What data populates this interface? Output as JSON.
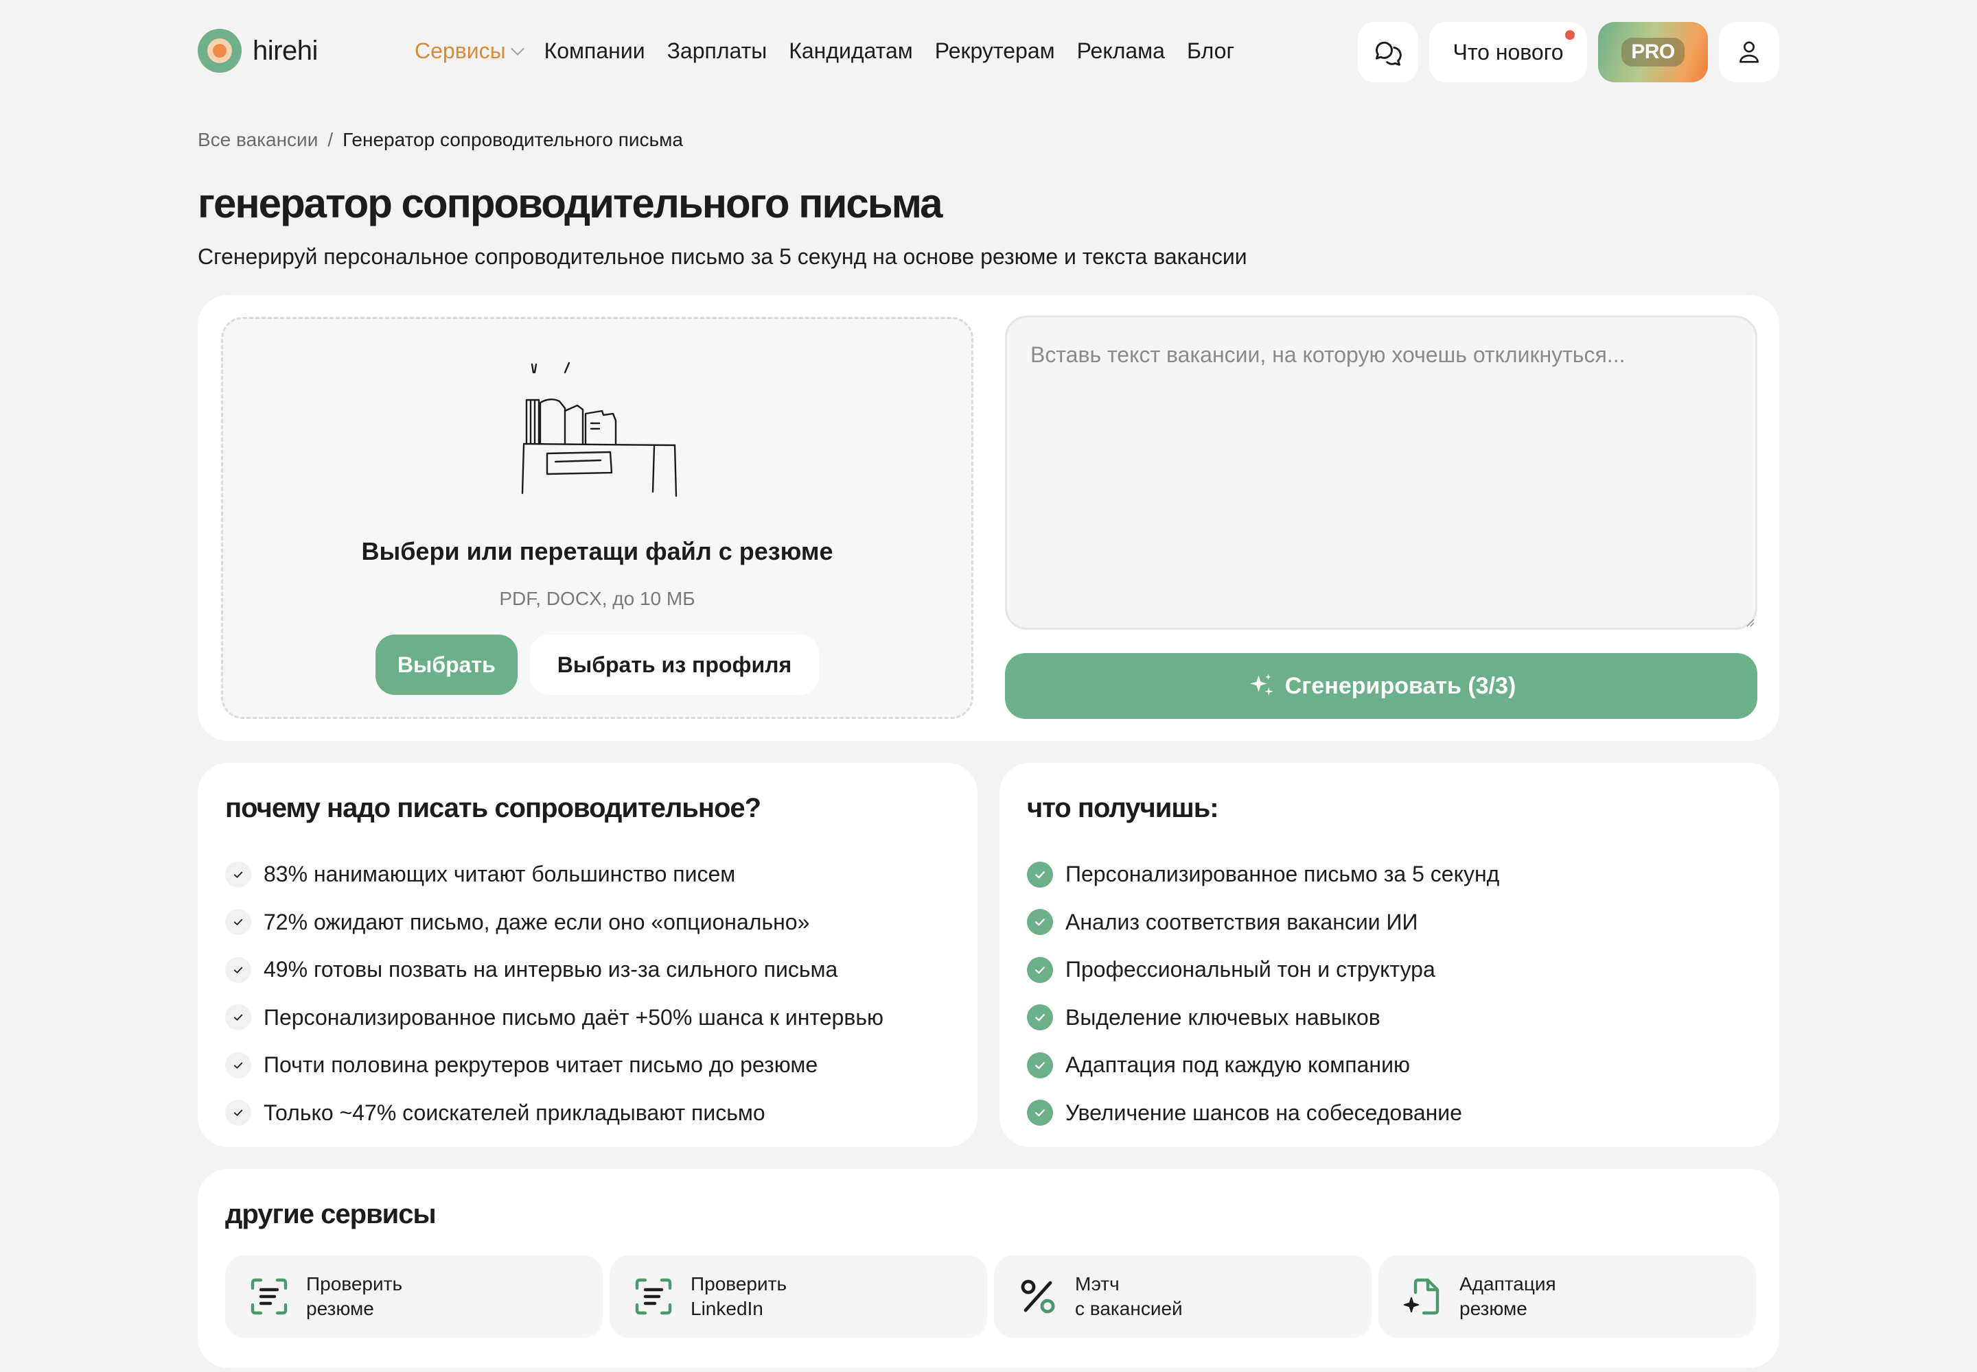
{
  "logo": {
    "text": "hirehi"
  },
  "nav": {
    "services": "Сервисы",
    "companies": "Компании",
    "salaries": "Зарплаты",
    "candidates": "Кандидатам",
    "recruiters": "Рекрутерам",
    "ads": "Реклама",
    "blog": "Блог"
  },
  "header": {
    "whats_new": "Что нового",
    "pro": "PRO"
  },
  "breadcrumb": {
    "all": "Все вакансии",
    "sep": "/",
    "current": "Генератор сопроводительного письма"
  },
  "page": {
    "title": "генератор сопроводительного письма",
    "subtitle": "Сгенерируй персональное сопроводительное письмо за 5 секунд на основе резюме и текста вакансии"
  },
  "upload": {
    "title": "Выбери или перетащи файл с резюме",
    "hint": "PDF, DOCX, до 10 МБ",
    "choose": "Выбрать",
    "from_profile": "Выбрать из профиля"
  },
  "vacancy": {
    "placeholder": "Вставь текст вакансии, на которую хочешь откликнуться...",
    "generate": "Сгенерировать (3/3)"
  },
  "why": {
    "title": "почему надо писать сопроводительное?",
    "items": [
      "83% нанимающих читают большинство писем",
      "72% ожидают письмо, даже если оно «опционально»",
      "49% готовы позвать на интервью из-за сильного письма",
      "Персонализированное письмо даёт +50% шанса к интервью",
      "Почти половина рекрутеров читает письмо до резюме",
      "Только ~47% соискателей прикладывают письмо"
    ]
  },
  "get": {
    "title": "что получишь:",
    "items": [
      "Персонализированное письмо за 5 секунд",
      "Анализ соответствия вакансии ИИ",
      "Профессиональный тон и структура",
      "Выделение ключевых навыков",
      "Адаптация под каждую компанию",
      "Увеличение шансов на собеседование"
    ]
  },
  "other": {
    "title": "другие сервисы",
    "items": [
      {
        "line1": "Проверить",
        "line2": "резюме",
        "icon": "resume-scan-icon"
      },
      {
        "line1": "Проверить",
        "line2": "LinkedIn",
        "icon": "linkedin-scan-icon"
      },
      {
        "line1": "Мэтч",
        "line2": "с вакансией",
        "icon": "percent-icon"
      },
      {
        "line1": "Адаптация",
        "line2": "резюме",
        "icon": "document-sparkle-icon"
      }
    ]
  },
  "colors": {
    "accent": "#6bb088",
    "nav_active": "#d88a3a",
    "bg": "#f3f3f3",
    "notify_dot": "#e85a4a"
  }
}
